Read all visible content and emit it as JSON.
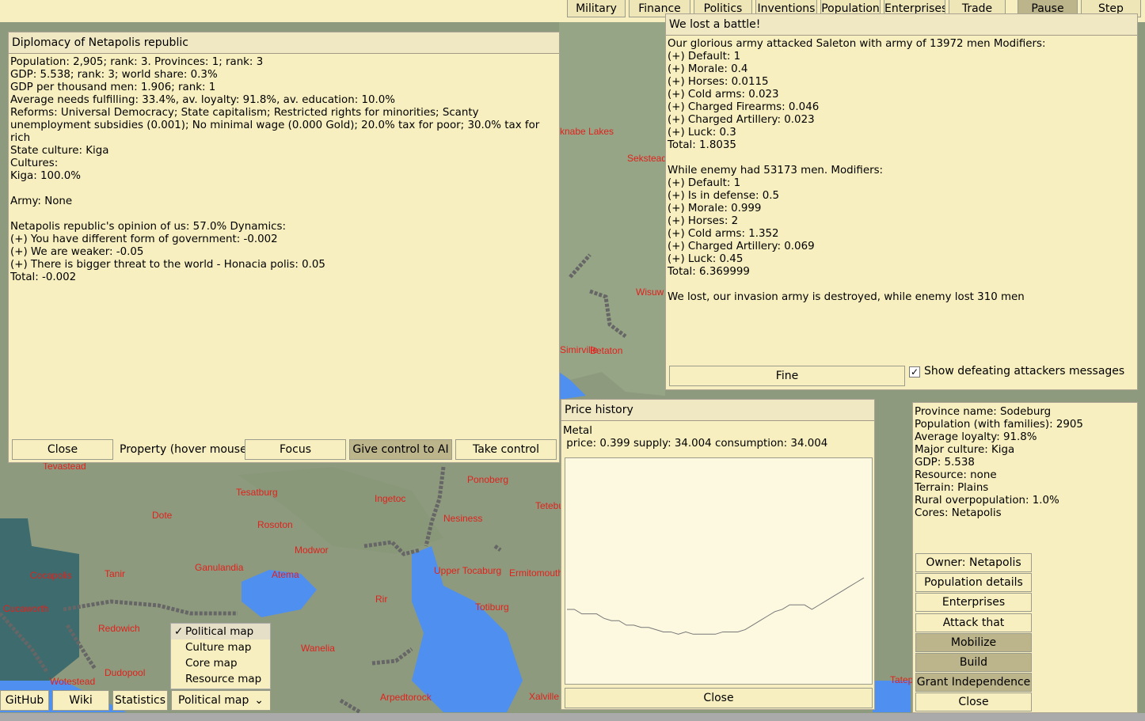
{
  "topbar": {
    "buttons": [
      "Military",
      "Finance",
      "Politics",
      "Inventions",
      "Population",
      "Enterprises",
      "Trade",
      "Pause",
      "Step"
    ]
  },
  "map": {
    "labels": [
      "knabe Lakes",
      "Sekstead",
      "Wisuw",
      "Simirville",
      "Betaton",
      "Tevastead",
      "Tesatburg",
      "Dote",
      "Rosoton",
      "Ingetoc",
      "Ponoberg",
      "Tetebu",
      "Nesiness",
      "Modwor",
      "Ganulandia",
      "Tanir",
      "Atema",
      "Cocapolis",
      "Upper Tocaburg",
      "Ermitomouth",
      "Cucaworth",
      "Rir",
      "Totiburg",
      "Redowich",
      "Wanelia",
      "Dudopool",
      "Wotestead",
      "Arpedtorock",
      "Xalville",
      "Tatep"
    ],
    "colors": {
      "land": "#8e9a7e",
      "water": "#4f8ff0",
      "teal": "#3d6b6e",
      "label": "#e0211c"
    }
  },
  "diplomacy": {
    "title": "Diplomacy of Netapolis republic",
    "text": "Population: 2,905; rank: 3. Provinces: 1; rank: 3\nGDP: 5.538; rank: 3; world share: 0.3%\nGDP per thousand men: 1.906; rank: 1\nAverage needs fulfilling: 33.4%, av. loyalty: 91.8%, av. education: 10.0%\nReforms: Universal Democracy; State capitalism; Restricted rights for minorities; Scanty unemployment subsidies (0.001); No minimal wage (0.000 Gold); 20.0% tax for poor; 30.0% tax for rich\nState culture: Kiga\nCultures:\n    Kiga: 100.0%\n\nArmy: None\n\nNetapolis republic's opinion of us: 57.0% Dynamics:\n(+) You have different form of government: -0.002\n(+) We are weaker: -0.05\n(+) There is bigger threat to the world - Honacia polis: 0.05\nTotal: -0.002",
    "close": "Close",
    "property": "Property (hover mouse)",
    "focus": "Focus",
    "give_ai": "Give control to AI",
    "take_control": "Take control"
  },
  "battle": {
    "title": "We lost a battle!",
    "text": "Our glorious army attacked Saleton with army of 13972 men Modifiers:\n(+) Default: 1\n(+) Morale: 0.4\n(+) Horses: 0.0115\n(+) Cold arms: 0.023\n(+) Charged Firearms: 0.046\n(+) Charged Artillery: 0.023\n(+) Luck: 0.3\nTotal: 1.8035\n\nWhile enemy had 53173 men. Modifiers:\n(+) Default: 1\n(+) Is in defense: 0.5\n(+) Morale: 0.999\n(+) Horses: 2\n(+) Cold arms: 1.352\n(+) Charged Artillery: 0.069\n(+) Luck: 0.45\nTotal: 6.369999\n\nWe lost, our invasion army is destroyed, while enemy lost 310 men",
    "fine": "Fine",
    "checkbox_label": "Show defeating attackers messages",
    "checkbox_checked": true
  },
  "price_history": {
    "title": "Price history",
    "product": "Metal",
    "stats": " price: 0.399 supply: 34.004 consumption: 34.004",
    "close": "Close"
  },
  "chart_data": {
    "type": "line",
    "title": "",
    "xlabel": "",
    "ylabel": "",
    "x": [
      0,
      1,
      2,
      3,
      4,
      5,
      6,
      7,
      8,
      9,
      10,
      11,
      12,
      13,
      14,
      15,
      16,
      17,
      18,
      19,
      20,
      21,
      22,
      23,
      24,
      25,
      26,
      27,
      28,
      29,
      30,
      31,
      32,
      33,
      34,
      35,
      36,
      37,
      38,
      39,
      40
    ],
    "series": [
      {
        "values": [
          0.33,
          0.33,
          0.31,
          0.31,
          0.31,
          0.29,
          0.28,
          0.28,
          0.26,
          0.26,
          0.25,
          0.25,
          0.24,
          0.23,
          0.23,
          0.22,
          0.23,
          0.22,
          0.22,
          0.22,
          0.22,
          0.23,
          0.23,
          0.23,
          0.24,
          0.26,
          0.28,
          0.3,
          0.32,
          0.33,
          0.35,
          0.35,
          0.35,
          0.33,
          0.35,
          0.37,
          0.39,
          0.41,
          0.43,
          0.45,
          0.47
        ]
      }
    ],
    "ylim": [
      0,
      1
    ]
  },
  "province": {
    "text": "Province name: Sodeburg\nPopulation (with families): 2905\nAverage loyalty: 91.8%\nMajor culture: Kiga\nGDP: 5.538\nResource: none\nTerrain: Plains\nRural overpopulation: 1.0%\nCores: Netapolis",
    "buttons": [
      "Owner: Netapolis",
      "Population details",
      "Enterprises",
      "Attack that",
      "Mobilize",
      "Build",
      "Grant Independence",
      "Close"
    ]
  },
  "bottom": {
    "github": "GitHub",
    "wiki": "Wiki",
    "statistics": "Statistics",
    "map_select": "Political map",
    "map_options": [
      "Political map",
      "Culture map",
      "Core map",
      "Resource map"
    ]
  }
}
